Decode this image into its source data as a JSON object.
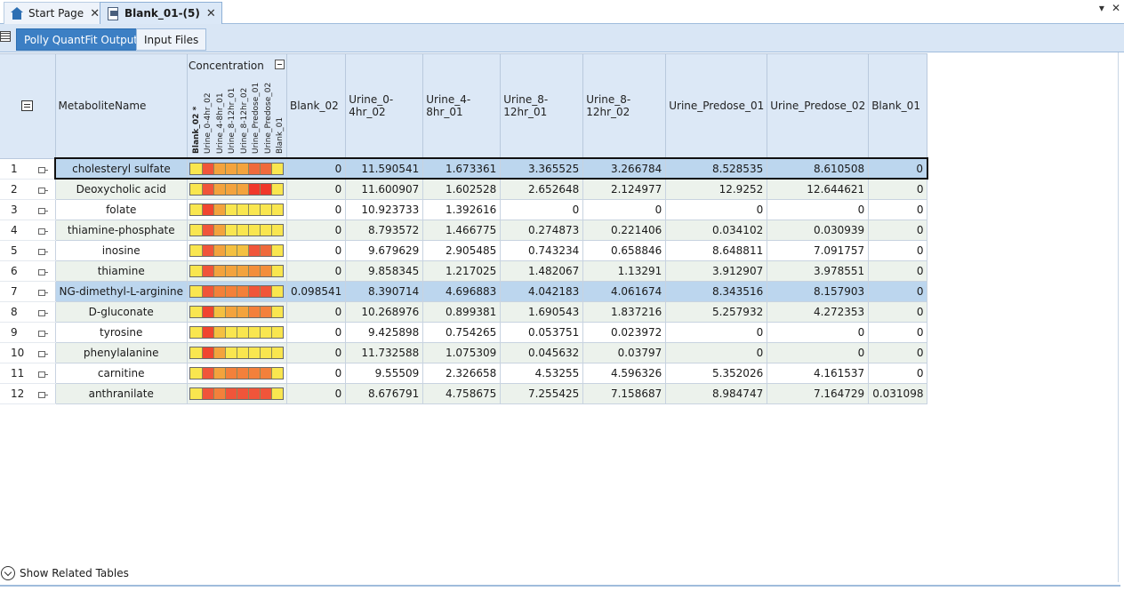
{
  "doc_tabs": [
    {
      "label": "Start Page",
      "icon": "home-icon",
      "close": "✕"
    },
    {
      "label": "Blank_01-(5)",
      "icon": "document-icon",
      "close": "✕"
    }
  ],
  "window_controls": {
    "dropdown": "▾",
    "close": "✕"
  },
  "sub_tabs": [
    {
      "label": "Polly QuantFit Output",
      "active": true
    },
    {
      "label": "Input Files",
      "active": false
    }
  ],
  "grid": {
    "headers": {
      "name": "MetaboliteName",
      "concentration": "Concentration",
      "concentration_labels": [
        "Blank_02 *",
        "Urine_0-4hr_02",
        "Urine_4-8hr_01",
        "Urine_8-12hr_01",
        "Urine_8-12hr_02",
        "Urine_Predose_01",
        "Urine_Predose_02",
        "Blank_01"
      ],
      "columns": [
        "Blank_02",
        "Urine_0-4hr_02",
        "Urine_4-8hr_01",
        "Urine_8-12hr_01",
        "Urine_8-12hr_02",
        "Urine_Predose_01",
        "Urine_Predose_02",
        "Blank_01"
      ]
    },
    "rows": [
      {
        "num": "1",
        "name": "cholesteryl sulfate",
        "values": [
          "0",
          "11.590541",
          "1.673361",
          "3.365525",
          "3.266784",
          "8.528535",
          "8.610508",
          "0"
        ],
        "heat": [
          "#f9e64f",
          "#f0553a",
          "#f3a33d",
          "#f3a33d",
          "#f3a33d",
          "#ef6a3c",
          "#ef6a3c",
          "#f9e64f"
        ]
      },
      {
        "num": "2",
        "name": "Deoxycholic acid",
        "values": [
          "0",
          "11.600907",
          "1.602528",
          "2.652648",
          "2.124977",
          "12.9252",
          "12.644621",
          "0"
        ],
        "heat": [
          "#f9e64f",
          "#f0553a",
          "#f3a33d",
          "#f3a33d",
          "#f3a33d",
          "#f0382a",
          "#f0382a",
          "#f9e64f"
        ]
      },
      {
        "num": "3",
        "name": "folate",
        "values": [
          "0",
          "10.923733",
          "1.392616",
          "0",
          "0",
          "0",
          "0",
          "0"
        ],
        "heat": [
          "#f9e64f",
          "#f0452f",
          "#f3a33d",
          "#f9e64f",
          "#f9e64f",
          "#f9e64f",
          "#f9e64f",
          "#f9e64f"
        ]
      },
      {
        "num": "4",
        "name": "thiamine-phosphate",
        "values": [
          "0",
          "8.793572",
          "1.466775",
          "0.274873",
          "0.221406",
          "0.034102",
          "0.030939",
          "0"
        ],
        "heat": [
          "#f9e64f",
          "#f0553a",
          "#f3a33d",
          "#f9e64f",
          "#f9e64f",
          "#f9e64f",
          "#f9e64f",
          "#f9e64f"
        ]
      },
      {
        "num": "5",
        "name": "inosine",
        "values": [
          "0",
          "9.679629",
          "2.905485",
          "0.743234",
          "0.658846",
          "8.648811",
          "7.091757",
          "0"
        ],
        "heat": [
          "#f9e64f",
          "#f0553a",
          "#f3a33d",
          "#f4c040",
          "#f4c040",
          "#f0553a",
          "#ef6a3c",
          "#f9e64f"
        ]
      },
      {
        "num": "6",
        "name": "thiamine",
        "values": [
          "0",
          "9.858345",
          "1.217025",
          "1.482067",
          "1.13291",
          "3.912907",
          "3.978551",
          "0"
        ],
        "heat": [
          "#f9e64f",
          "#f0553a",
          "#f3a33d",
          "#f3a33d",
          "#f3a33d",
          "#f38e3b",
          "#f38e3b",
          "#f9e64f"
        ]
      },
      {
        "num": "7",
        "name": "NG-dimethyl-L-arginine",
        "values": [
          "0.098541",
          "8.390714",
          "4.696883",
          "4.042183",
          "4.061674",
          "8.343516",
          "8.157903",
          "0"
        ],
        "heat": [
          "#f9e64f",
          "#f0553a",
          "#f3803b",
          "#f3803b",
          "#f3803b",
          "#f0553a",
          "#f0553a",
          "#f9e64f"
        ]
      },
      {
        "num": "8",
        "name": "D-gluconate",
        "values": [
          "0",
          "10.268976",
          "0.899381",
          "1.690543",
          "1.837216",
          "5.257932",
          "4.272353",
          "0"
        ],
        "heat": [
          "#f9e64f",
          "#f0452f",
          "#f4c040",
          "#f3a33d",
          "#f3a33d",
          "#f3803b",
          "#f3803b",
          "#f9e64f"
        ]
      },
      {
        "num": "9",
        "name": "tyrosine",
        "values": [
          "0",
          "9.425898",
          "0.754265",
          "0.053751",
          "0.023972",
          "0",
          "0",
          "0"
        ],
        "heat": [
          "#f9e64f",
          "#f0452f",
          "#f4c040",
          "#f9e64f",
          "#f9e64f",
          "#f9e64f",
          "#f9e64f",
          "#f9e64f"
        ]
      },
      {
        "num": "10",
        "name": "phenylalanine",
        "values": [
          "0",
          "11.732588",
          "1.075309",
          "0.045632",
          "0.03797",
          "0",
          "0",
          "0"
        ],
        "heat": [
          "#f9e64f",
          "#f0452f",
          "#f3a33d",
          "#f9e64f",
          "#f9e64f",
          "#f9e64f",
          "#f9e64f",
          "#f9e64f"
        ]
      },
      {
        "num": "11",
        "name": "carnitine",
        "values": [
          "0",
          "9.55509",
          "2.326658",
          "4.53255",
          "4.596326",
          "5.352026",
          "4.161537",
          "0"
        ],
        "heat": [
          "#f9e64f",
          "#f0553a",
          "#f3a33d",
          "#f3803b",
          "#f3803b",
          "#f3803b",
          "#f3803b",
          "#f9e64f"
        ]
      },
      {
        "num": "12",
        "name": "anthranilate",
        "values": [
          "0",
          "8.676791",
          "4.758675",
          "7.255425",
          "7.158687",
          "8.984747",
          "7.164729",
          "0.031098"
        ],
        "heat": [
          "#f9e64f",
          "#f0553a",
          "#f3803b",
          "#f0553a",
          "#f0553a",
          "#f0553a",
          "#f0553a",
          "#f9e64f"
        ]
      }
    ],
    "selected_row": 6,
    "current_row": 0
  },
  "footer": {
    "label": "Show Related Tables"
  }
}
